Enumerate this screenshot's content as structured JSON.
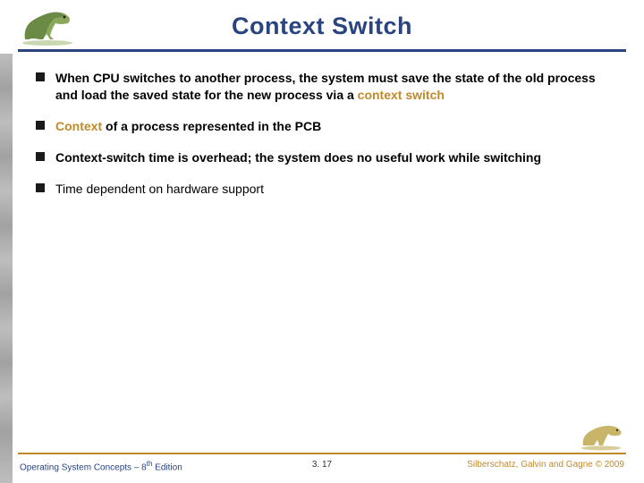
{
  "title": "Context Switch",
  "bullets": [
    {
      "pre": "When CPU switches to another process, the system must save the state of the old process and load the saved state for the new process via a ",
      "hl": "context switch",
      "post": ""
    },
    {
      "pre": "",
      "hl": "Context",
      "post": " of a process represented in the PCB"
    },
    {
      "pre": "Context-switch time is overhead; the system does no useful work while switching",
      "hl": "",
      "post": ""
    },
    {
      "pre": "Time dependent on hardware support",
      "hl": "",
      "post": ""
    }
  ],
  "footer": {
    "left_a": "Operating System Concepts – 8",
    "left_sup": "th",
    "left_b": " Edition",
    "center": "3. 17",
    "right": "Silberschatz, Galvin and Gagne © 2009"
  },
  "icons": {
    "header_dino": "dinosaur-icon",
    "footer_dino": "dinosaur-small-icon"
  }
}
